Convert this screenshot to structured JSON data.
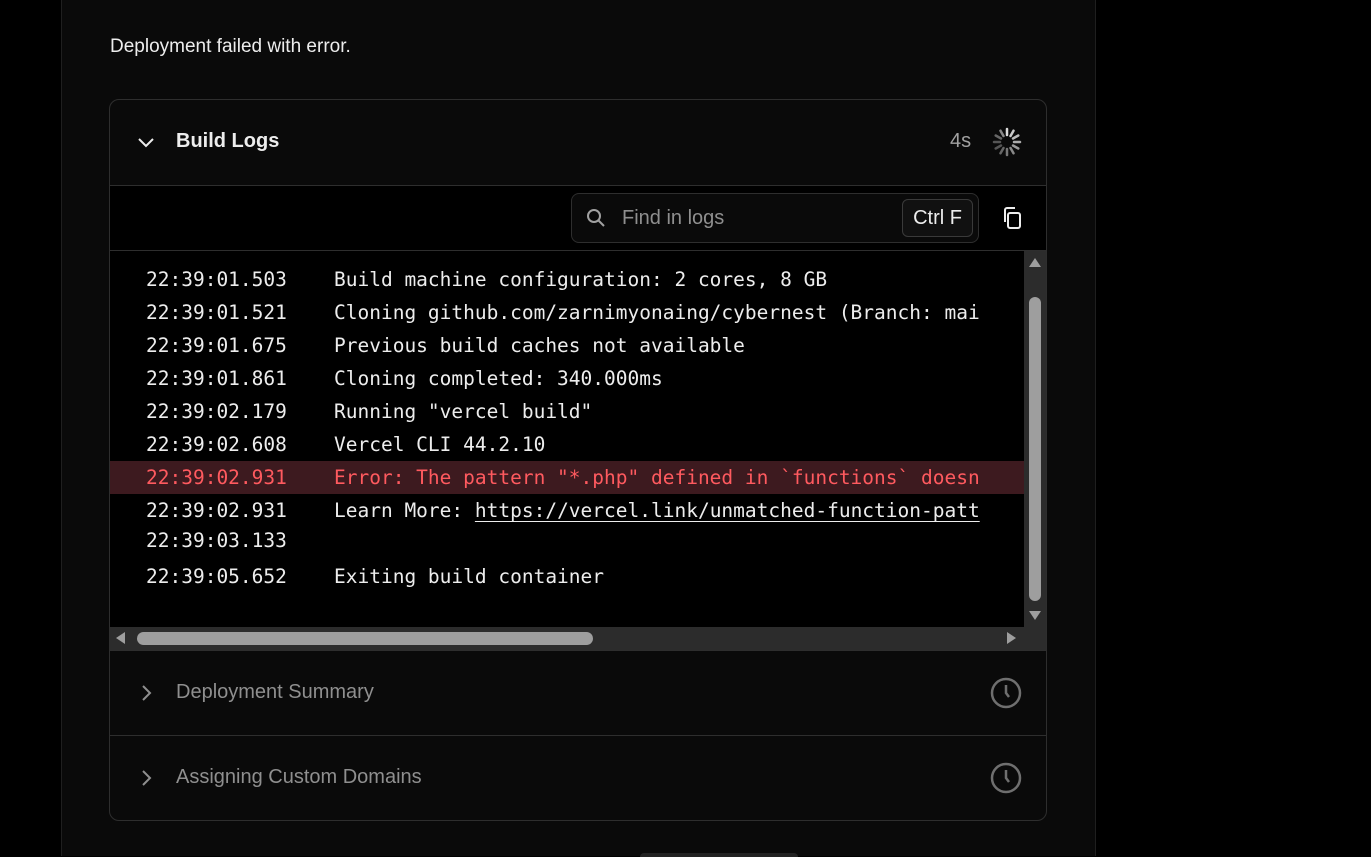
{
  "status_message": "Deployment failed with error.",
  "build_logs": {
    "title": "Build Logs",
    "duration": "4s",
    "search_placeholder": "Find in logs",
    "search_value": "",
    "shortcut": "Ctrl F",
    "lines": [
      {
        "time": "22:39:01.503",
        "text": "Build machine configuration: 2 cores, 8 GB"
      },
      {
        "time": "22:39:01.521",
        "text": "Cloning github.com/zarnimyonaing/cybernest (Branch: mai"
      },
      {
        "time": "22:39:01.675",
        "text": "Previous build caches not available"
      },
      {
        "time": "22:39:01.861",
        "text": "Cloning completed: 340.000ms"
      },
      {
        "time": "22:39:02.179",
        "text": "Running \"vercel build\""
      },
      {
        "time": "22:39:02.608",
        "text": "Vercel CLI 44.2.10"
      },
      {
        "time": "22:39:02.931",
        "text": "Error: The pattern \"*.php\" defined in `functions` doesn",
        "level": "error"
      },
      {
        "time": "22:39:02.931",
        "text": "Learn More: ",
        "link": "https://vercel.link/unmatched-function-patt"
      },
      {
        "time": "22:39:03.133",
        "text": ""
      },
      {
        "time": "22:39:05.652",
        "text": "Exiting build container"
      }
    ]
  },
  "sections": [
    {
      "title": "Deployment Summary",
      "icon": "clock-icon"
    },
    {
      "title": "Assigning Custom Domains",
      "icon": "clock-icon"
    }
  ],
  "colors": {
    "error_text": "#ff5a5f",
    "error_bg": "#3d1a1f",
    "background": "#000000"
  }
}
